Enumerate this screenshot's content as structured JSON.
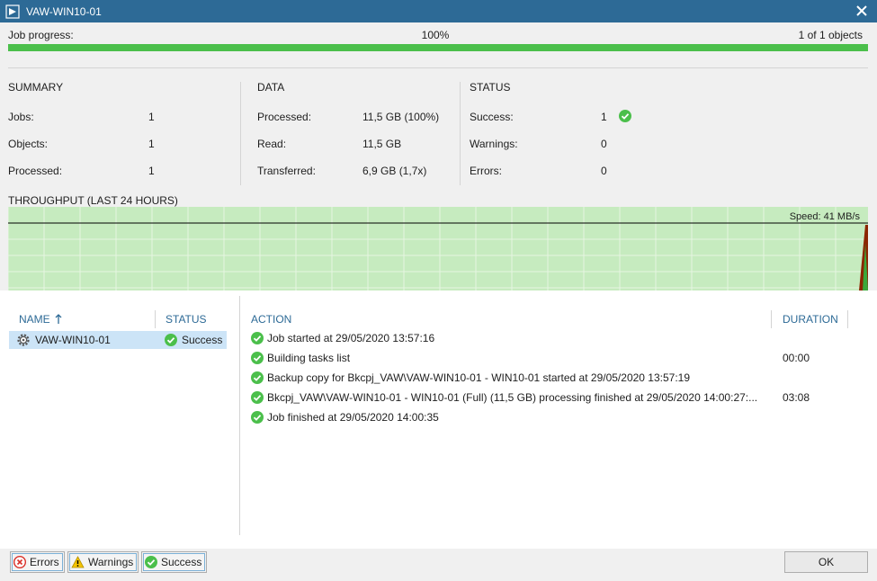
{
  "window": {
    "title": "VAW-WIN10-01"
  },
  "progress": {
    "label": "Job progress:",
    "percent_text": "100%",
    "objects_text": "1 of 1 objects",
    "fraction": 1.0
  },
  "summary": {
    "title": "SUMMARY",
    "rows": [
      {
        "label": "Jobs:",
        "value": "1"
      },
      {
        "label": "Objects:",
        "value": "1"
      },
      {
        "label": "Processed:",
        "value": "1"
      }
    ]
  },
  "data_section": {
    "title": "DATA",
    "rows": [
      {
        "label": "Processed:",
        "value": "11,5 GB (100%)"
      },
      {
        "label": "Read:",
        "value": "11,5 GB"
      },
      {
        "label": "Transferred:",
        "value": "6,9 GB (1,7x)"
      }
    ]
  },
  "status_section": {
    "title": "STATUS",
    "rows": [
      {
        "label": "Success:",
        "value": "1"
      },
      {
        "label": "Warnings:",
        "value": "0"
      },
      {
        "label": "Errors:",
        "value": "0"
      }
    ]
  },
  "throughput": {
    "title": "THROUGHPUT (LAST 24 HOURS)",
    "speed_label": "Speed: 41 MB/s",
    "fill_color": "#c6ebbf",
    "peak_color": "#8b2500"
  },
  "objects_list": {
    "headers": {
      "name": "NAME",
      "status": "STATUS"
    },
    "rows": [
      {
        "name": "VAW-WIN10-01",
        "status": "Success"
      }
    ]
  },
  "log": {
    "headers": {
      "action": "ACTION",
      "duration": "DURATION"
    },
    "rows": [
      {
        "action": "Job started at 29/05/2020 13:57:16",
        "duration": ""
      },
      {
        "action": "Building tasks list",
        "duration": "00:00"
      },
      {
        "action": "Backup copy for Bkcpj_VAW\\VAW-WIN10-01 - WIN10-01 started at 29/05/2020 13:57:19",
        "duration": ""
      },
      {
        "action": "Bkcpj_VAW\\VAW-WIN10-01 - WIN10-01 (Full) (11,5 GB) processing finished at 29/05/2020 14:00:27:...",
        "duration": "03:08"
      },
      {
        "action": "Job finished at 29/05/2020 14:00:35",
        "duration": ""
      }
    ]
  },
  "footer": {
    "errors_label": "Errors",
    "warnings_label": "Warnings",
    "success_label": "Success",
    "ok_label": "OK"
  },
  "colors": {
    "accent": "#2d6a96",
    "success": "#4bbf4b",
    "selection": "#cce4f7"
  }
}
